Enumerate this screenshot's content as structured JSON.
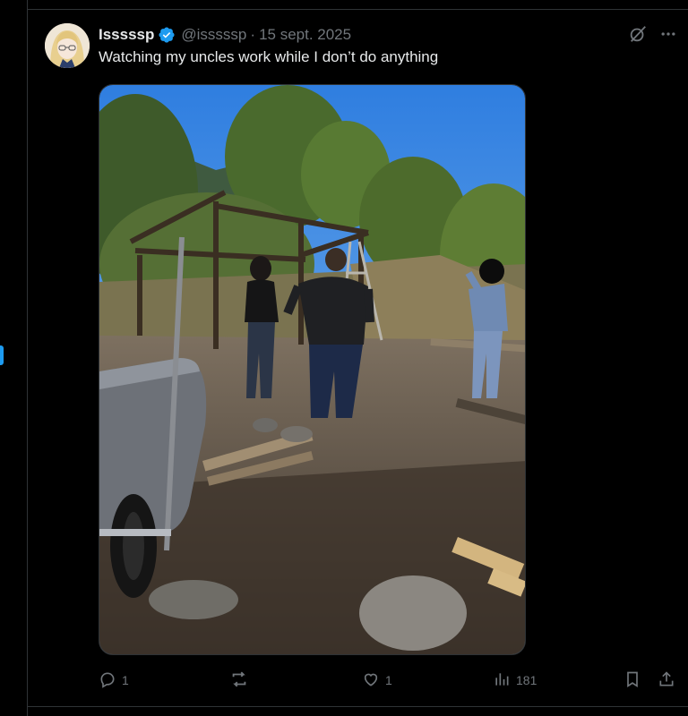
{
  "tweet": {
    "display_name": "Isssssp",
    "handle": "@isssssp",
    "separator": "·",
    "date": "15 sept. 2025",
    "text": "Watching my uncles work while I don’t do anything",
    "media_alt": "Photo of people building a wooden frame structure outdoors near trees, with a wheelbarrow in the foreground"
  },
  "actions": {
    "replies": "1",
    "reposts": "",
    "likes": "1",
    "views": "181"
  },
  "colors": {
    "background": "#000000",
    "text": "#e7e9ea",
    "muted": "#71767b",
    "accent": "#1d9bf0",
    "divider": "#2f3336"
  },
  "icons": [
    "verified-badge-icon",
    "grok-icon",
    "more-icon",
    "reply-icon",
    "repost-icon",
    "like-icon",
    "views-icon",
    "bookmark-icon",
    "share-icon"
  ]
}
